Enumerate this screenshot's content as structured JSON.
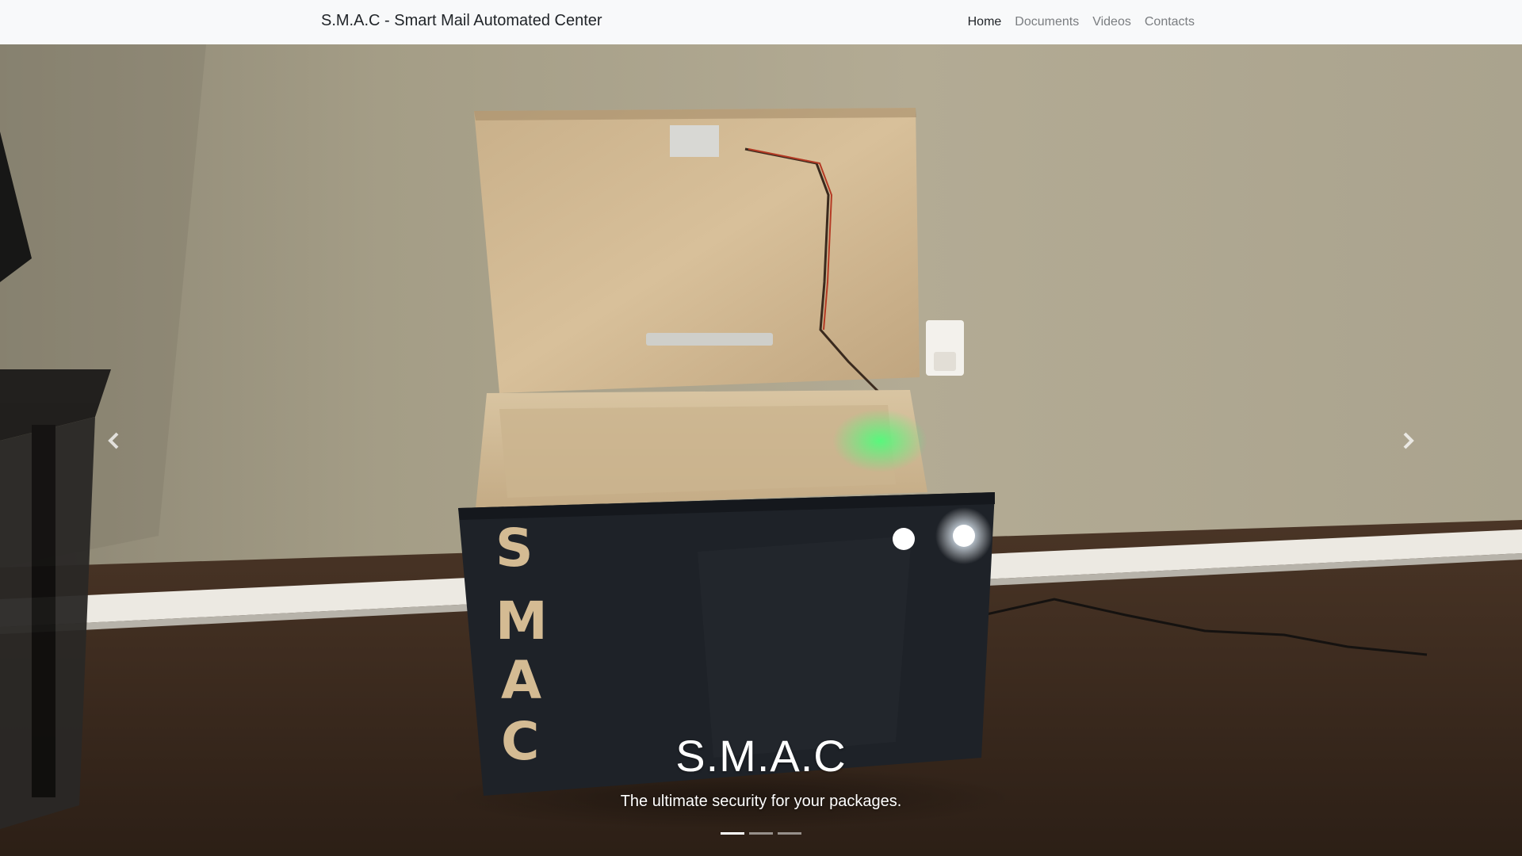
{
  "navbar": {
    "brand": "S.M.A.C - Smart Mail Automated Center",
    "links": [
      {
        "label": "Home",
        "active": true
      },
      {
        "label": "Documents",
        "active": false
      },
      {
        "label": "Videos",
        "active": false
      },
      {
        "label": "Contacts",
        "active": false
      }
    ]
  },
  "carousel": {
    "caption_title": "S.M.A.C",
    "caption_text": "The ultimate security for your packages.",
    "box_lettering": [
      "S",
      "M",
      "A",
      "C"
    ],
    "slide_count": 3,
    "active_slide": 1,
    "controls": {
      "prev_icon": "chevron-left-icon",
      "next_icon": "chevron-right-icon"
    }
  },
  "colors": {
    "navbar_bg": "#f8f9fa",
    "nav_active": "#212529",
    "nav_inactive": "#7a7d80",
    "caption_text": "#ffffff"
  }
}
